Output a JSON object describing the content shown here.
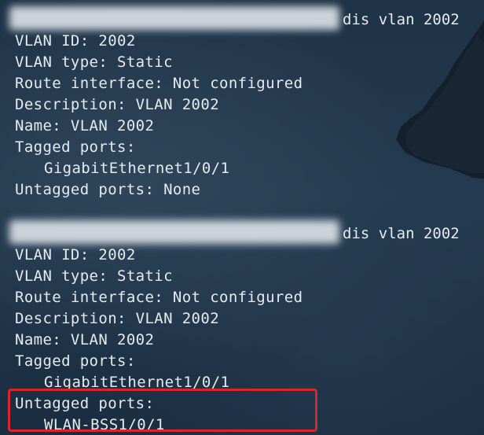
{
  "terminal": {
    "block1": {
      "command_tail": "dis vlan 2002",
      "lines": [
        "VLAN ID: 2002",
        "VLAN type: Static",
        "Route interface: Not configured",
        "Description: VLAN 2002",
        "Name: VLAN 2002",
        "Tagged ports:",
        "GigabitEthernet1/0/1",
        "Untagged ports: None"
      ]
    },
    "block2": {
      "command_tail": "dis vlan 2002",
      "lines": [
        "VLAN ID: 2002",
        "VLAN type: Static",
        "Route interface: Not configured",
        "Description: VLAN 2002",
        "Name: VLAN 2002",
        "Tagged ports:",
        "GigabitEthernet1/0/1",
        "Untagged ports:",
        "WLAN-BSS1/0/1"
      ]
    }
  },
  "colors": {
    "text": "#e7ebef",
    "highlight_border": "#d8262c"
  }
}
